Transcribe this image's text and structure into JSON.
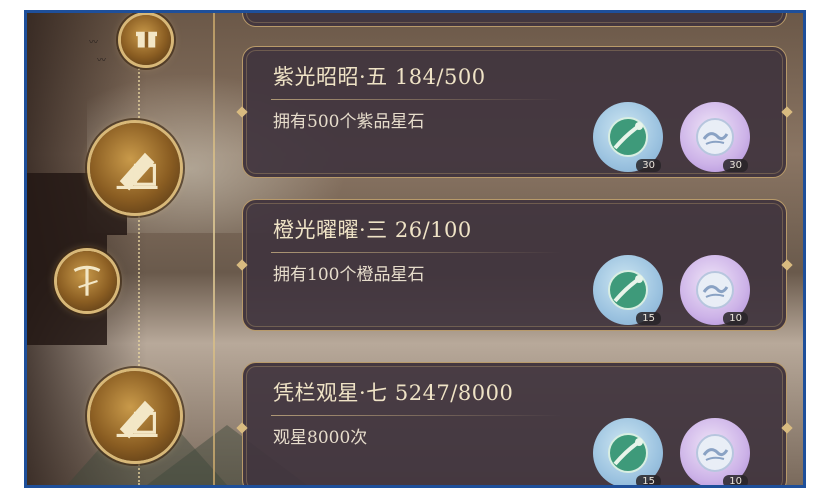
{
  "colors": {
    "frame": "#1e4f9a",
    "card_bg": "#403440",
    "gold": "#d8b878",
    "title_text": "#efe3c6"
  },
  "tasks": [
    {
      "title": "紫光昭昭·五 184/500",
      "desc": "拥有500个紫品星石",
      "rewards": [
        {
          "icon": "jade-ruyi-icon",
          "count": "30"
        },
        {
          "icon": "cloud-coin-icon",
          "count": "30"
        }
      ]
    },
    {
      "title": "橙光曜曜·三 26/100",
      "desc": "拥有100个橙品星石",
      "rewards": [
        {
          "icon": "jade-ruyi-icon",
          "count": "15"
        },
        {
          "icon": "cloud-coin-icon",
          "count": "10"
        }
      ]
    },
    {
      "title": "凭栏观星·七 5247/8000",
      "desc": "观星8000次",
      "rewards": [
        {
          "icon": "jade-ruyi-icon",
          "count": "15"
        },
        {
          "icon": "cloud-coin-icon",
          "count": "10"
        }
      ]
    }
  ]
}
